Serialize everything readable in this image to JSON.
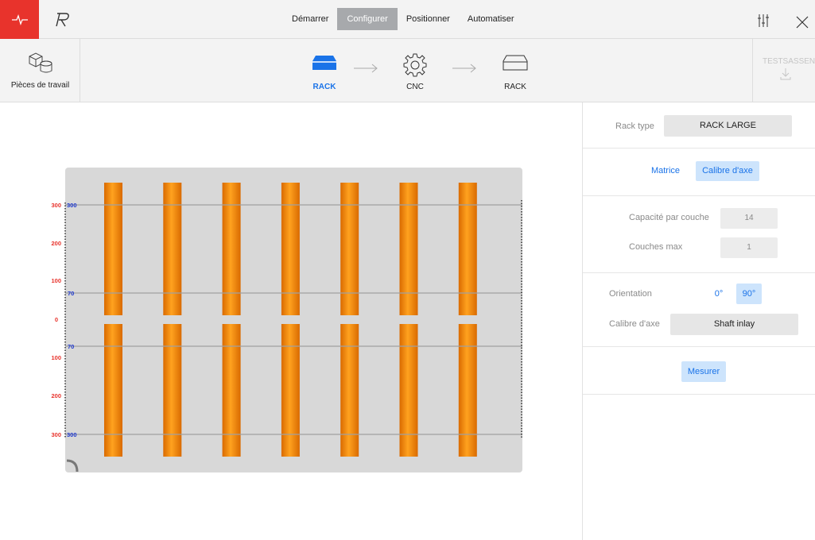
{
  "topbar": {
    "nav": [
      "Démarrer",
      "Configurer",
      "Positionner",
      "Automatiser"
    ],
    "active_nav": "Configurer"
  },
  "toolbar": {
    "workpieces_label": "Pièces de travail",
    "steps": [
      "RACK",
      "CNC",
      "RACK"
    ],
    "active_step": 0,
    "export_label": "TESTSASSEN"
  },
  "panel": {
    "rack_type_label": "Rack type",
    "rack_type_value": "RACK LARGE",
    "mode_matrix": "Matrice",
    "mode_calibre": "Calibre d'axe",
    "capacity_label": "Capacité par couche",
    "capacity_value": "14",
    "layers_label": "Couches max",
    "layers_value": "1",
    "orientation_label": "Orientation",
    "orientation_0": "0°",
    "orientation_90": "90°",
    "calibre_label": "Calibre d'axe",
    "calibre_value": "Shaft inlay",
    "measure_button": "Mesurer"
  },
  "rack_view": {
    "red_labels": [
      "300",
      "200",
      "100",
      "0",
      "100",
      "200",
      "300"
    ],
    "blue_labels": [
      "300",
      "70",
      "70",
      "300"
    ],
    "rod_count": 7,
    "colors": {
      "rod": "#f7941d",
      "rod_dark": "#d96a00",
      "rack_bg": "#d8d8d8",
      "red": "#e8332c",
      "blue": "#1f3ad1"
    }
  }
}
